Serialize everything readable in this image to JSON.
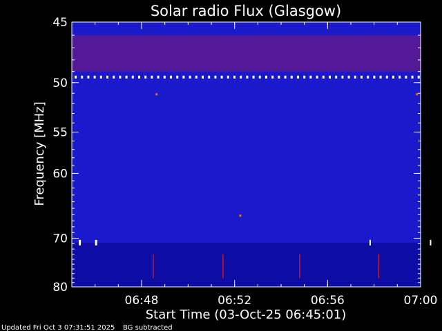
{
  "chart_data": {
    "type": "heatmap",
    "title": "Solar radio Flux (Glasgow)",
    "xlabel": "Start Time (03-Oct-25 06:45:01)",
    "ylabel": "Frequency [MHz]",
    "x_ticks": [
      "06:48",
      "06:52",
      "06:56",
      "07:00"
    ],
    "x_tick_minutes": [
      3,
      7,
      11,
      15
    ],
    "xlim_minutes": [
      0,
      15
    ],
    "y_ticks": [
      45,
      50,
      55,
      60,
      70,
      80
    ],
    "ylim": [
      45,
      80
    ],
    "y_scale": "reciprocal",
    "colormap": [
      "#000080",
      "#1a1acc",
      "#3a2ee6",
      "#c01a3a",
      "#ff6a00",
      "#ffffff"
    ],
    "features": {
      "persistent_band_mhz": 49.5,
      "interference_band_mhz": [
        46,
        49
      ],
      "intermittent_band_mhz": 70.8,
      "burst_times_minutes": [
        3.5,
        6.5,
        9.8,
        13.2
      ]
    }
  },
  "footer": {
    "updated": "Updated Fri Oct  3 07:31:51 2025",
    "note": "BG subtracted"
  }
}
